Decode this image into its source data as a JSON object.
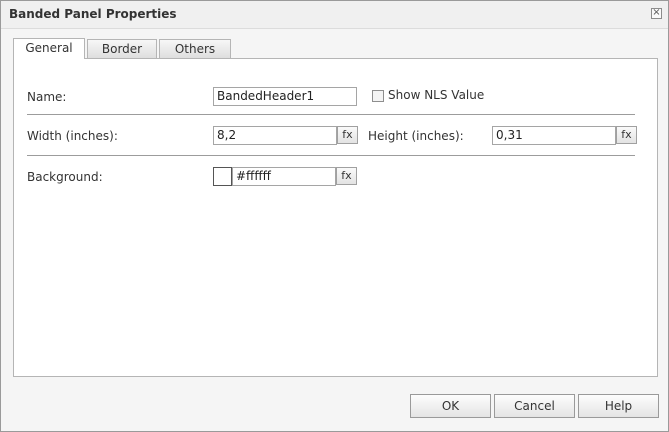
{
  "dialog": {
    "title": "Banded Panel Properties",
    "close_glyph": "×"
  },
  "tabs": [
    {
      "label": "General",
      "active": true
    },
    {
      "label": "Border",
      "active": false
    },
    {
      "label": "Others",
      "active": false
    }
  ],
  "general": {
    "name_label": "Name:",
    "name_value": "BandedHeader1",
    "show_nls_label": "Show NLS Value",
    "show_nls_checked": false,
    "width_label": "Width (inches):",
    "width_value": "8,2",
    "height_label": "Height (inches):",
    "height_value": "0,31",
    "background_label": "Background:",
    "background_value": "#ffffff",
    "background_color": "#ffffff",
    "fx_label": "fx"
  },
  "buttons": {
    "ok": "OK",
    "cancel": "Cancel",
    "help": "Help"
  }
}
